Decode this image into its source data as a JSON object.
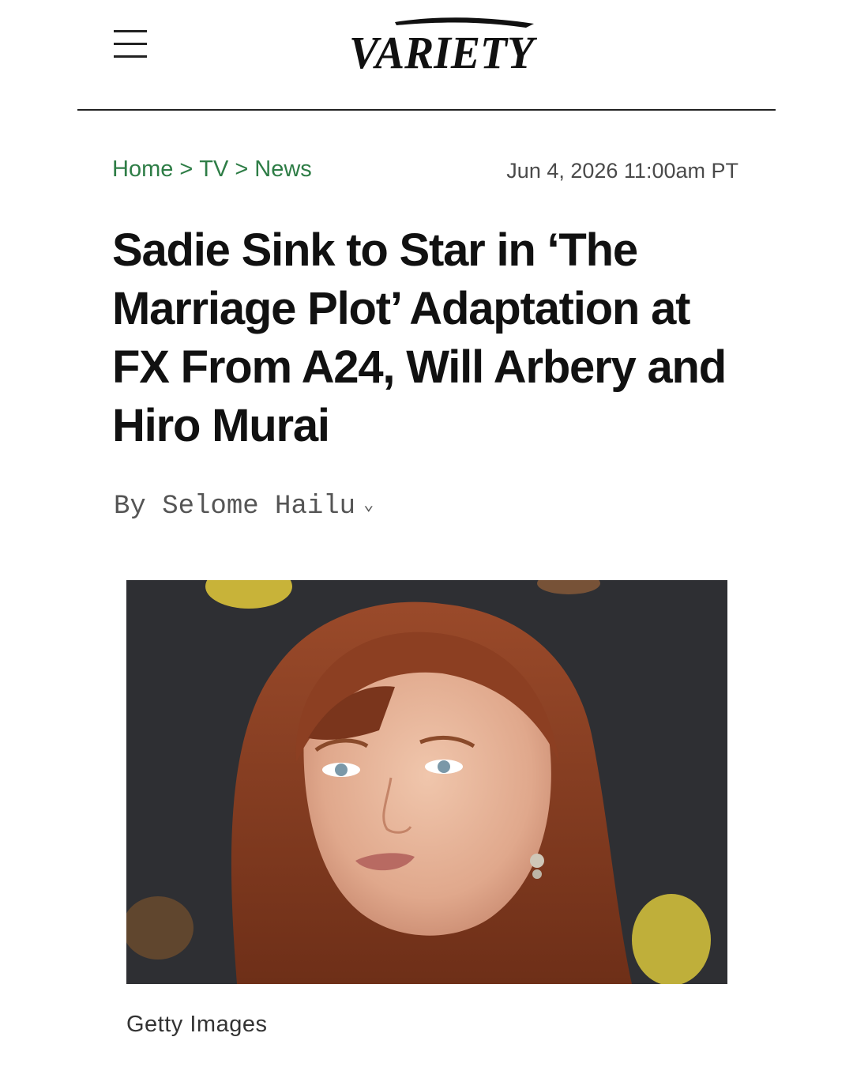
{
  "header": {
    "menu_icon": "hamburger-menu-icon",
    "logo_text": "VARIETY"
  },
  "breadcrumb": {
    "items": [
      "Home",
      "TV",
      "News"
    ],
    "separator": ">"
  },
  "article": {
    "timestamp": "Jun 4, 2026 11:00am PT",
    "headline": "Sadie Sink to Star in ‘The Marriage Plot’ Adaptation at FX From A24, Will Arbery and Hiro Murai",
    "byline_prefix": "By",
    "author": "Selome Hailu",
    "byline_icon": "chevron-down-icon",
    "image_credit": "Getty Images"
  },
  "colors": {
    "breadcrumb": "#2e7d46",
    "text": "#111111",
    "muted": "#555555"
  }
}
